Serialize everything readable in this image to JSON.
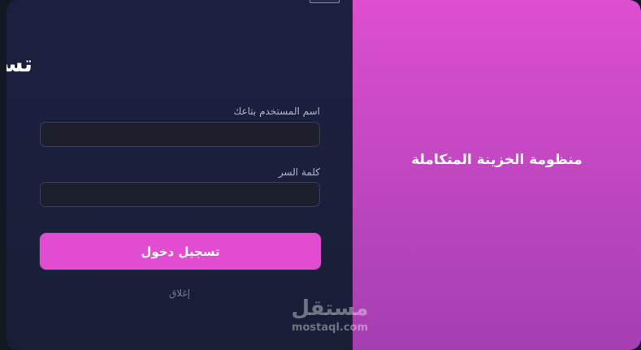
{
  "login": {
    "title": "تسجيل دخولك",
    "username_label": "اسم المستخدم بتاعك",
    "username_value": "",
    "password_label": "كلمة السر",
    "password_value": "",
    "submit_label": "تسجيل دخول",
    "close_label": "إغلاق"
  },
  "brand": {
    "title": "منظومة الخزينة المتكاملة"
  },
  "watermark": {
    "arabic": "مستقل",
    "latin": "mostaql.com"
  },
  "colors": {
    "accent": "#e14cd0",
    "panel_gradient_top": "#dd4fcf",
    "panel_gradient_bottom": "#a43fb1",
    "form_background": "#1b2040"
  }
}
